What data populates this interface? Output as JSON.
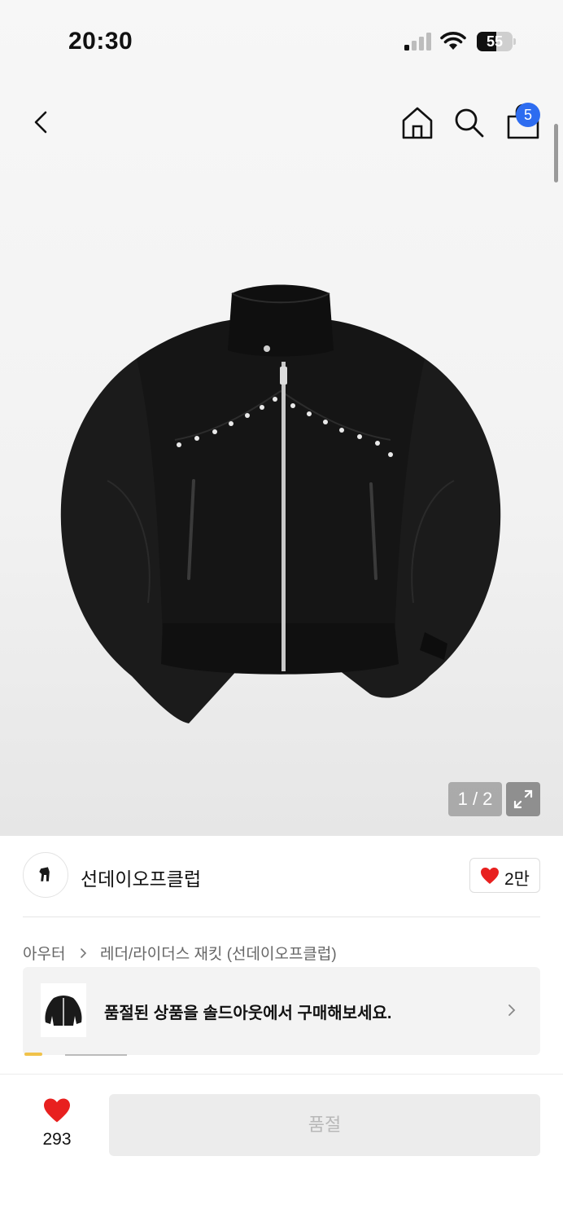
{
  "status_bar": {
    "time": "20:30",
    "battery_text": "55",
    "battery_level": 0.55
  },
  "nav": {
    "back_icon": "chevron-left-icon",
    "home_icon": "home-icon",
    "search_icon": "search-icon",
    "cart_icon": "shopping-bag-icon",
    "cart_count": "5",
    "badge_color": "#2d6cf0"
  },
  "gallery": {
    "counter": "1 / 2",
    "expand_icon": "expand-icon",
    "product_image": "black-leather-rider-jacket"
  },
  "brand": {
    "name": "선데이오프클럽",
    "likes": "2만",
    "heart_color": "#e8201f"
  },
  "breadcrumb": {
    "category": "아우터",
    "subcategory": "레더/라이더스 재킷 (선데이오프클럽)"
  },
  "soldout_banner": {
    "text": "품절된 상품을 솔드아웃에서 구매해보세요."
  },
  "bottom_bar": {
    "like_count": "293",
    "buy_label": "품절"
  }
}
